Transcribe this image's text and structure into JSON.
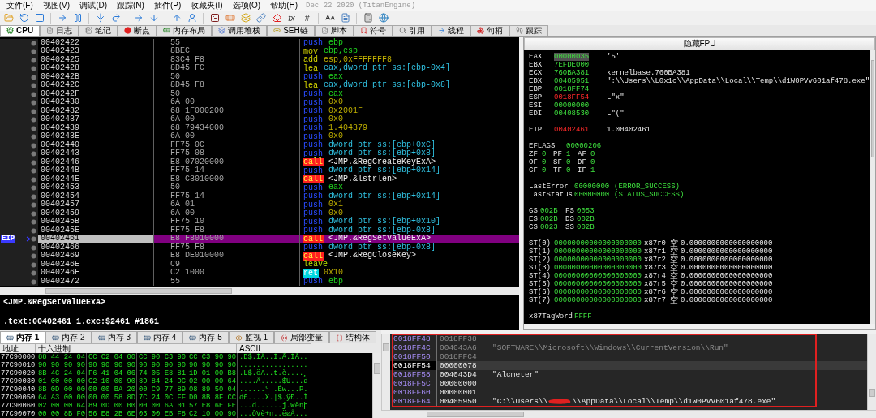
{
  "menu": [
    "文件(F)",
    "视图(V)",
    "调试(D)",
    "跟踪(N)",
    "插件(P)",
    "收藏夹(I)",
    "选项(O)",
    "帮助(H)"
  ],
  "build": "Dec 22 2020 (TitanEngine)",
  "toolbar_labels": [
    "fx",
    "#"
  ],
  "tabs": [
    {
      "label": "CPU",
      "selected": true
    },
    {
      "label": "日志",
      "selected": false
    },
    {
      "label": "笔记",
      "selected": false
    },
    {
      "label": "断点",
      "selected": false
    },
    {
      "label": "内存布局",
      "selected": false
    },
    {
      "label": "调用堆栈",
      "selected": false
    },
    {
      "label": "SEH链",
      "selected": false
    },
    {
      "label": "脚本",
      "selected": false
    },
    {
      "label": "符号",
      "selected": false
    },
    {
      "label": "引用",
      "selected": false
    },
    {
      "label": "线程",
      "selected": false
    },
    {
      "label": "句柄",
      "selected": false
    },
    {
      "label": "跟踪",
      "selected": false
    }
  ],
  "disassembly": [
    {
      "address": "00402422",
      "bytes": "55",
      "mnemonic": "push",
      "kind": "push",
      "operands": {
        "text": "ebp",
        "kind": "reg"
      },
      "selected": false
    },
    {
      "address": "00402423",
      "bytes": "8BEC",
      "mnemonic": "mov",
      "kind": "move",
      "operands": {
        "text": "ebp,esp",
        "kind": "reg"
      },
      "selected": false
    },
    {
      "address": "00402425",
      "bytes": "83C4 F8",
      "mnemonic": "add",
      "kind": "move",
      "operands": {
        "text": "esp,0xFFFFFFF8",
        "kind": "imm"
      },
      "selected": false
    },
    {
      "address": "00402428",
      "bytes": "8D45 FC",
      "mnemonic": "lea",
      "kind": "move",
      "operands": {
        "text": "eax,dword ptr ss:[ebp-0x4]",
        "kind": "mem"
      },
      "selected": false
    },
    {
      "address": "0040242B",
      "bytes": "50",
      "mnemonic": "push",
      "kind": "push",
      "operands": {
        "text": "eax",
        "kind": "reg"
      },
      "selected": false
    },
    {
      "address": "0040242C",
      "bytes": "8D45 F8",
      "mnemonic": "lea",
      "kind": "move",
      "operands": {
        "text": "eax,dword ptr ss:[ebp-0x8]",
        "kind": "mem"
      },
      "selected": false
    },
    {
      "address": "0040242F",
      "bytes": "50",
      "mnemonic": "push",
      "kind": "push",
      "operands": {
        "text": "eax",
        "kind": "reg"
      },
      "selected": false
    },
    {
      "address": "00402430",
      "bytes": "6A 00",
      "mnemonic": "push",
      "kind": "push",
      "operands": {
        "text": "0x0",
        "kind": "imm"
      },
      "selected": false
    },
    {
      "address": "00402432",
      "bytes": "68 1F000200",
      "mnemonic": "push",
      "kind": "push",
      "operands": {
        "text": "0x2001F",
        "kind": "imm"
      },
      "selected": false
    },
    {
      "address": "00402437",
      "bytes": "6A 00",
      "mnemonic": "push",
      "kind": "push",
      "operands": {
        "text": "0x0",
        "kind": "imm"
      },
      "selected": false
    },
    {
      "address": "00402439",
      "bytes": "68 79434000",
      "mnemonic": "push",
      "kind": "push",
      "operands": {
        "text": "1.404379",
        "kind": "imm"
      },
      "selected": false
    },
    {
      "address": "0040243E",
      "bytes": "6A 00",
      "mnemonic": "push",
      "kind": "push",
      "operands": {
        "text": "0x0",
        "kind": "imm"
      },
      "selected": false
    },
    {
      "address": "00402440",
      "bytes": "FF75 0C",
      "mnemonic": "push",
      "kind": "push",
      "operands": {
        "text": "dword ptr ss:[ebp+0xC]",
        "kind": "mem"
      },
      "selected": false
    },
    {
      "address": "00402443",
      "bytes": "FF75 08",
      "mnemonic": "push",
      "kind": "push",
      "operands": {
        "text": "dword ptr ss:[ebp+0x8]",
        "kind": "mem"
      },
      "selected": false
    },
    {
      "address": "00402446",
      "bytes": "E8 07020000",
      "mnemonic": "call",
      "kind": "call",
      "operands": {
        "text": "<JMP.&RegCreateKeyExA>",
        "kind": "label"
      },
      "selected": false
    },
    {
      "address": "0040244B",
      "bytes": "FF75 14",
      "mnemonic": "push",
      "kind": "push",
      "operands": {
        "text": "dword ptr ss:[ebp+0x14]",
        "kind": "mem"
      },
      "selected": false
    },
    {
      "address": "0040244E",
      "bytes": "E8 C3010000",
      "mnemonic": "call",
      "kind": "call",
      "operands": {
        "text": "<JMP.&lstrlen>",
        "kind": "label"
      },
      "selected": false
    },
    {
      "address": "00402453",
      "bytes": "50",
      "mnemonic": "push",
      "kind": "push",
      "operands": {
        "text": "eax",
        "kind": "reg"
      },
      "selected": false
    },
    {
      "address": "00402454",
      "bytes": "FF75 14",
      "mnemonic": "push",
      "kind": "push",
      "operands": {
        "text": "dword ptr ss:[ebp+0x14]",
        "kind": "mem"
      },
      "selected": false
    },
    {
      "address": "00402457",
      "bytes": "6A 01",
      "mnemonic": "push",
      "kind": "push",
      "operands": {
        "text": "0x1",
        "kind": "imm"
      },
      "selected": false
    },
    {
      "address": "00402459",
      "bytes": "6A 00",
      "mnemonic": "push",
      "kind": "push",
      "operands": {
        "text": "0x0",
        "kind": "imm"
      },
      "selected": false
    },
    {
      "address": "0040245B",
      "bytes": "FF75 10",
      "mnemonic": "push",
      "kind": "push",
      "operands": {
        "text": "dword ptr ss:[ebp+0x10]",
        "kind": "mem"
      },
      "selected": false
    },
    {
      "address": "0040245E",
      "bytes": "FF75 F8",
      "mnemonic": "push",
      "kind": "push",
      "operands": {
        "text": "dword ptr ss:[ebp-0x8]",
        "kind": "mem"
      },
      "selected": false
    },
    {
      "address": "00402461",
      "bytes": "E8 F8010000",
      "mnemonic": "call",
      "kind": "call",
      "operands": {
        "text": "<JMP.&RegSetValueExA>",
        "kind": "label"
      },
      "selected": true,
      "gutter_label": "EIP"
    },
    {
      "address": "00402466",
      "bytes": "FF75 F8",
      "mnemonic": "push",
      "kind": "push",
      "operands": {
        "text": "dword ptr ss:[ebp-0x8]",
        "kind": "mem"
      },
      "selected": false
    },
    {
      "address": "00402469",
      "bytes": "E8 DE010000",
      "mnemonic": "call",
      "kind": "call",
      "operands": {
        "text": "<JMP.&RegCloseKey>",
        "kind": "label"
      },
      "selected": false
    },
    {
      "address": "0040246E",
      "bytes": "C9",
      "mnemonic": "leave",
      "kind": "leave",
      "selected": false
    },
    {
      "address": "0040246F",
      "bytes": "C2 1000",
      "mnemonic": "ret",
      "kind": "ret",
      "operands": {
        "text": "0x10",
        "kind": "imm"
      },
      "selected": false
    },
    {
      "address": "00402472",
      "bytes": "55",
      "mnemonic": "push",
      "kind": "push",
      "operands": {
        "text": "ebp",
        "kind": "reg"
      },
      "selected": false
    }
  ],
  "info": {
    "symbol": "<JMP.&RegSetValueExA>",
    "location": ".text:00402461 1.exe:$2461 #1861"
  },
  "registers": {
    "header": "隐藏FPU",
    "gprs": [
      {
        "name": "EAX",
        "value": "00000035",
        "comment": "'5'",
        "changed": false,
        "selected": true
      },
      {
        "name": "EBX",
        "value": "7EFDE000",
        "changed": false,
        "selected": false
      },
      {
        "name": "ECX",
        "value": "760BA381",
        "comment": "kernelbase.760BA381",
        "changed": false,
        "selected": false
      },
      {
        "name": "EDX",
        "value": "00405951",
        "comment": "\":\\\\Users\\\\L0x1c\\\\AppData\\\\Local\\\\Temp\\\\d1W0PVv601af478.exe\"",
        "changed": false,
        "selected": false
      },
      {
        "name": "EBP",
        "value": "0018FF74",
        "changed": false,
        "selected": false
      },
      {
        "name": "ESP",
        "value": "0018FF54",
        "comment": "L\"x\"",
        "changed": true,
        "selected": false
      },
      {
        "name": "ESI",
        "value": "00000000",
        "changed": false,
        "selected": false
      },
      {
        "name": "EDI",
        "value": "00408530",
        "comment": "L\"(\"",
        "changed": false,
        "selected": false
      }
    ],
    "eip": {
      "name": "EIP",
      "value": "00402461",
      "comment": "1.00402461",
      "changed": true
    },
    "eflags": {
      "name": "EFLAGS",
      "value": "00000206"
    },
    "flags": [
      [
        {
          "name": "ZF",
          "value": "0"
        },
        {
          "name": "PF",
          "value": "1"
        },
        {
          "name": "AF",
          "value": "0"
        }
      ],
      [
        {
          "name": "OF",
          "value": "0"
        },
        {
          "name": "SF",
          "value": "0"
        },
        {
          "name": "DF",
          "value": "0"
        }
      ],
      [
        {
          "name": "CF",
          "value": "0"
        },
        {
          "name": "TF",
          "value": "0"
        },
        {
          "name": "IF",
          "value": "1"
        }
      ]
    ],
    "last": [
      {
        "name": "LastError",
        "value": "00000000",
        "text": "(ERROR_SUCCESS)"
      },
      {
        "name": "LastStatus",
        "value": "00000000",
        "text": "(STATUS_SUCCESS)"
      }
    ],
    "segments": [
      [
        {
          "name": "GS",
          "value": "002B"
        },
        {
          "name": "FS",
          "value": "0053"
        }
      ],
      [
        {
          "name": "ES",
          "value": "002B"
        },
        {
          "name": "DS",
          "value": "002B"
        }
      ],
      [
        {
          "name": "CS",
          "value": "0023"
        },
        {
          "name": "SS",
          "value": "002B"
        }
      ]
    ],
    "fpu": [
      {
        "name": "ST(0)",
        "value": "00000000000000000000",
        "reg": "x87r0",
        "tag": "空",
        "float": "0.0000000000000000000"
      },
      {
        "name": "ST(1)",
        "value": "00000000000000000000",
        "reg": "x87r1",
        "tag": "空",
        "float": "0.0000000000000000000"
      },
      {
        "name": "ST(2)",
        "value": "00000000000000000000",
        "reg": "x87r2",
        "tag": "空",
        "float": "0.0000000000000000000"
      },
      {
        "name": "ST(3)",
        "value": "00000000000000000000",
        "reg": "x87r3",
        "tag": "空",
        "float": "0.0000000000000000000"
      },
      {
        "name": "ST(4)",
        "value": "00000000000000000000",
        "reg": "x87r4",
        "tag": "空",
        "float": "0.0000000000000000000"
      },
      {
        "name": "ST(5)",
        "value": "00000000000000000000",
        "reg": "x87r5",
        "tag": "空",
        "float": "0.0000000000000000000"
      },
      {
        "name": "ST(6)",
        "value": "00000000000000000000",
        "reg": "x87r6",
        "tag": "空",
        "float": "0.0000000000000000000"
      },
      {
        "name": "ST(7)",
        "value": "00000000000000000000",
        "reg": "x87r7",
        "tag": "空",
        "float": "0.0000000000000000000"
      }
    ],
    "tagword": {
      "name": "x87TagWord",
      "value": "FFFF"
    }
  },
  "memory_tabs": [
    {
      "label": "内存 1",
      "selected": true
    },
    {
      "label": "内存 2",
      "selected": false
    },
    {
      "label": "内存 3",
      "selected": false
    },
    {
      "label": "内存 4",
      "selected": false
    },
    {
      "label": "内存 5",
      "selected": false
    },
    {
      "label": "监视 1",
      "selected": false
    },
    {
      "label": "局部变量",
      "selected": false
    },
    {
      "label": "结构体",
      "selected": false
    }
  ],
  "dump": {
    "columns": [
      "地址",
      "十六进制",
      "ASCII"
    ],
    "rows": [
      {
        "address": "77C90000",
        "hex": [
          "88 44 24 04",
          "CC C2 04 00",
          "CC 90 C3 90",
          "CC C3 90 90"
        ],
        "ascii": ".D$.ÌÂ..Ì.Ã.ÌÃ.."
      },
      {
        "address": "77C90010",
        "hex": [
          "90 90 90 90",
          "90 90 90 90",
          "90 90 90 90",
          "90 90 90 90"
        ],
        "ascii": "................"
      },
      {
        "address": "77C90020",
        "hex": [
          "8B 4C 24 04",
          "F6 41 04 06",
          "74 05 E8 81",
          "1D 01 00 B8"
        ],
        "ascii": ".L$.öA..t.è....¸"
      },
      {
        "address": "77C90030",
        "hex": [
          "01 00 00 00",
          "C2 10 00 90",
          "8D 84 24 DC",
          "02 00 00 64"
        ],
        "ascii": "....Â.....$Ü...d"
      },
      {
        "address": "77C90040",
        "hex": [
          "8B 0D 00 00",
          "00 00 BA 20",
          "00 C9 77 89",
          "08 89 50 04"
        ],
        "ascii": "......º .Éw...P."
      },
      {
        "address": "77C90050",
        "hex": [
          "64 A3 00 00",
          "00 00 58 8D",
          "7C 24 0C FF",
          "D0 8B 8F CC"
        ],
        "ascii": "d£....X.|$.ÿÐ..Ì"
      },
      {
        "address": "77C90060",
        "hex": [
          "02 00 00 64",
          "89 0D 00 00",
          "00 00 6A 01",
          "57 E8 6E FE"
        ],
        "ascii": "...d......j.Wènþ"
      },
      {
        "address": "77C90070",
        "hex": [
          "00 00 8B F0",
          "56 E8 2B 6E",
          "03 00 EB F8",
          "C2 10 00 90"
        ],
        "ascii": "...ðVè+n..ëøÂ..."
      }
    ]
  },
  "stack": [
    {
      "address": "0018FF48",
      "value": "0018FF38",
      "dimmed": true,
      "selected": false
    },
    {
      "address": "0018FF4C",
      "value": "004043A6",
      "comment": "\"SOFTWARE\\\\Microsoft\\\\Windows\\\\CurrentVersion\\\\Run\"",
      "dimmed": true,
      "selected": false
    },
    {
      "address": "0018FF50",
      "value": "0018FFC4",
      "dimmed": true,
      "selected": false
    },
    {
      "address": "0018FF54",
      "value": "00000078",
      "dimmed": false,
      "selected": true
    },
    {
      "address": "0018FF58",
      "value": "004043D4",
      "comment": "\"Alcmeter\"",
      "dimmed": false,
      "selected": false
    },
    {
      "address": "0018FF5C",
      "value": "00000000",
      "dimmed": false,
      "selected": false
    },
    {
      "address": "0018FF60",
      "value": "00000001",
      "dimmed": false,
      "selected": false
    },
    {
      "address": "0018FF64",
      "value": "00405950",
      "comment": "\"C:\\\\Users\\\\",
      "redacted": true,
      "comment_after": "\\\\AppData\\\\Local\\\\Temp\\\\d1W0PVv601af478.exe\"",
      "dimmed": false,
      "selected": false
    }
  ]
}
